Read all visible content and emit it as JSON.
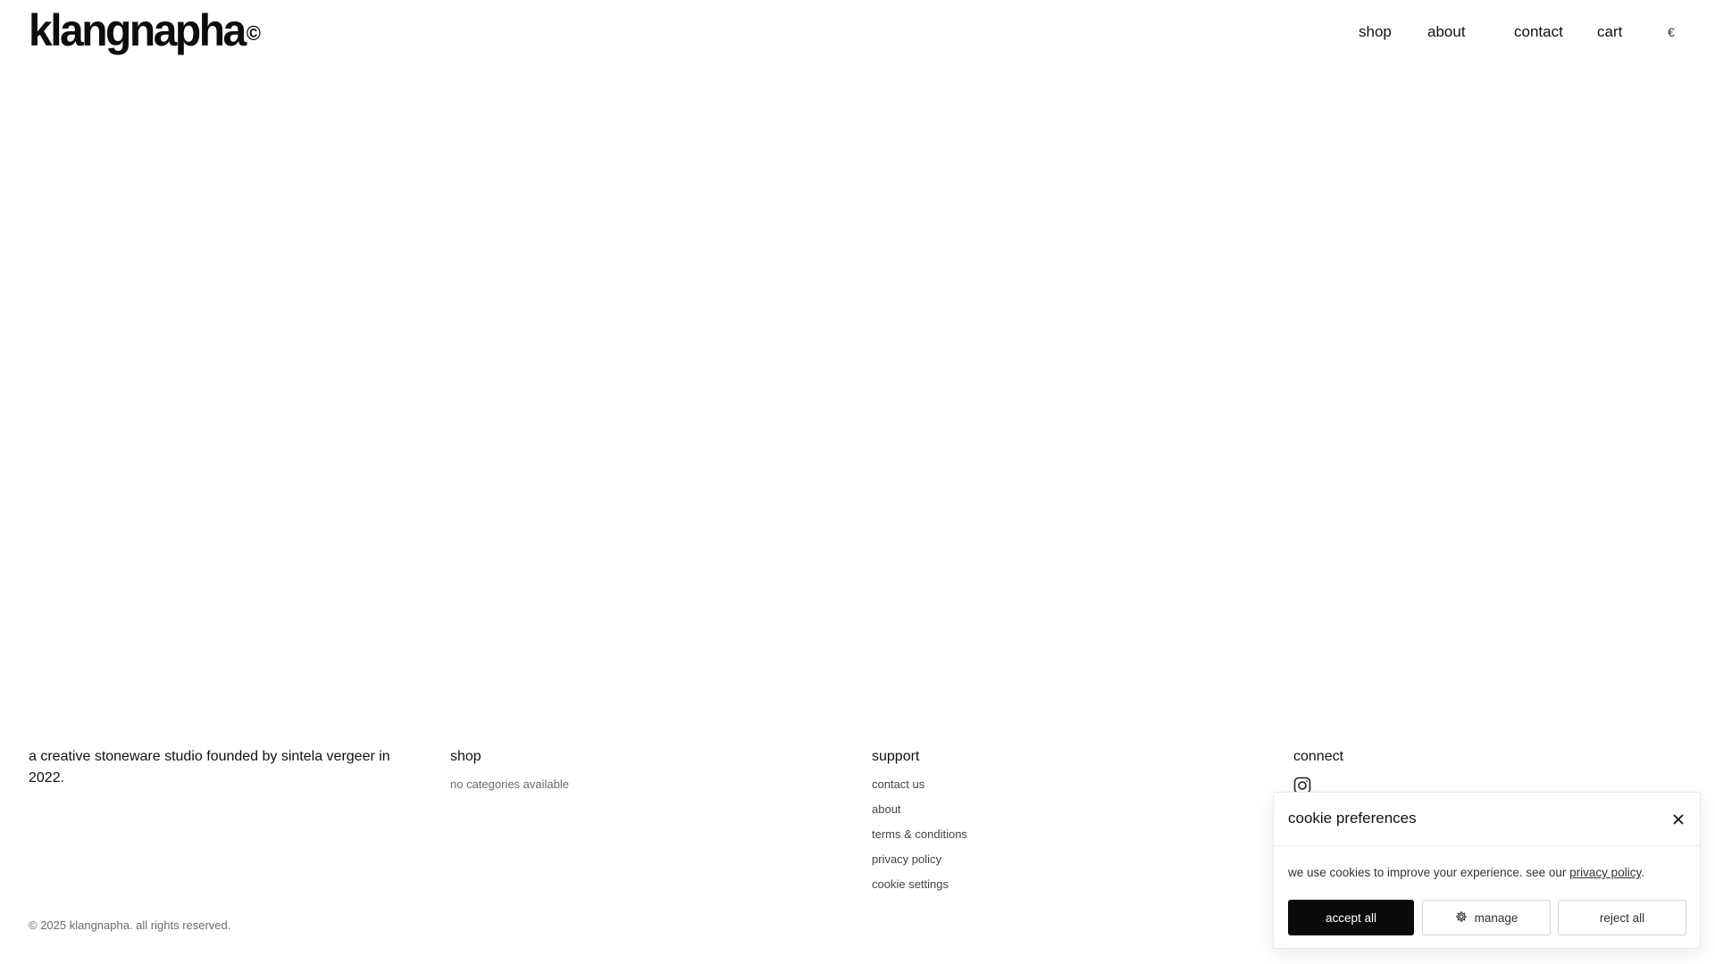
{
  "header": {
    "logo_text": "klangnapha",
    "logo_mark": "©",
    "nav": {
      "shop": "shop",
      "about": "about",
      "contact": "contact",
      "cart": "cart",
      "currency": "€"
    }
  },
  "footer": {
    "about_text": "a creative stoneware studio founded by sintela vergeer in 2022.",
    "shop": {
      "title": "shop",
      "empty_text": "no categories available"
    },
    "support": {
      "title": "support",
      "links": [
        "contact us",
        "about",
        "terms & conditions",
        "privacy policy",
        "cookie settings"
      ]
    },
    "connect": {
      "title": "connect",
      "icons": [
        "instagram-icon"
      ]
    },
    "copyright": "© 2025 klangnapha. all rights reserved."
  },
  "cookie": {
    "title": "cookie preferences",
    "text_before": "we use cookies to improve your experience. see our ",
    "link_text": "privacy policy",
    "text_after": ".",
    "buttons": {
      "accept": "accept all",
      "manage": "manage",
      "reject": "reject all"
    },
    "close_icon": "close-icon",
    "manage_icon": "gear-icon"
  },
  "colors": {
    "text": "#111111",
    "muted": "#6b6b6b",
    "primary_button": "#0a0a0a",
    "border": "#d4d4d4"
  }
}
